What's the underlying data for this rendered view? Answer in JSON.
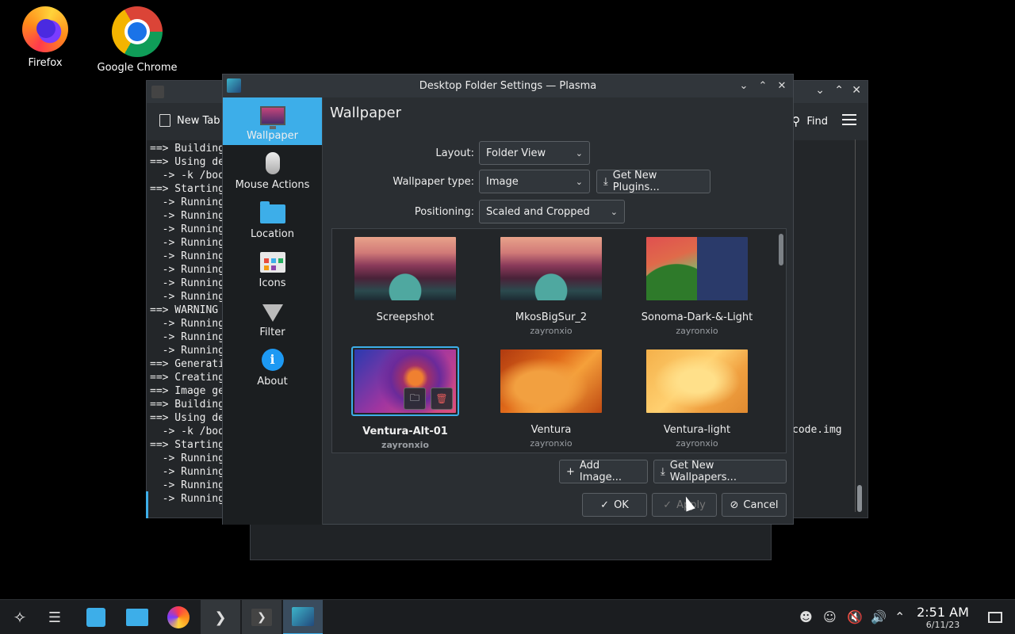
{
  "desktop": {
    "icons": [
      {
        "label": "Firefox"
      },
      {
        "label": "Google Chrome"
      }
    ]
  },
  "konsole": {
    "new_tab_label": "New Tab",
    "find_label": "Find",
    "terminal_lines": "==> Building\n==> Using de\n  -> -k /boo\n==> Starting\n  -> Running\n  -> Running\n  -> Running\n  -> Running\n  -> Running\n  -> Running\n  -> Running\n  -> Running\n==> WARNING\n  -> Running\n  -> Running\n  -> Running\n==> Generati\n==> Creating\n==> Image ge\n==> Building\n==> Using de\n  -> -k /boo\n==> Starting\n  -> Running\n  -> Running\n  -> Running\n  -> Running",
    "terminal_tail": "code.img"
  },
  "dialog": {
    "title": "Desktop Folder Settings — Plasma",
    "sidebar": [
      {
        "label": "Wallpaper",
        "icon": "monitor-icon",
        "active": true
      },
      {
        "label": "Mouse Actions",
        "icon": "mouse-icon",
        "active": false
      },
      {
        "label": "Location",
        "icon": "folder-icon",
        "active": false
      },
      {
        "label": "Icons",
        "icon": "icons-icon",
        "active": false
      },
      {
        "label": "Filter",
        "icon": "filter-icon",
        "active": false
      },
      {
        "label": "About",
        "icon": "info-icon",
        "active": false
      }
    ],
    "page_title": "Wallpaper",
    "layout": {
      "label": "Layout:",
      "value": "Folder View"
    },
    "wallpaper_type": {
      "label": "Wallpaper type:",
      "value": "Image",
      "get_plugins": "Get New Plugins..."
    },
    "positioning": {
      "label": "Positioning:",
      "value": "Scaled and Cropped"
    },
    "wallpapers": [
      {
        "name": "Screepshot",
        "author": ""
      },
      {
        "name": "MkosBigSur_2",
        "author": "zayronxio"
      },
      {
        "name": "Sonoma-Dark-&-Light",
        "author": "zayronxio"
      },
      {
        "name": "Ventura-Alt-01",
        "author": "zayronxio",
        "selected": true
      },
      {
        "name": "Ventura",
        "author": "zayronxio"
      },
      {
        "name": "Ventura-light",
        "author": "zayronxio"
      }
    ],
    "add_image": "Add Image...",
    "get_wallpapers": "Get New Wallpapers...",
    "ok": "OK",
    "apply": "Apply",
    "cancel": "Cancel"
  },
  "taskbar": {
    "time": "2:51 AM",
    "date": "6/11/23"
  },
  "colors": {
    "accent": "#3daee9",
    "window_bg": "#2a2e32",
    "sidebar_bg": "#1b1e20"
  }
}
